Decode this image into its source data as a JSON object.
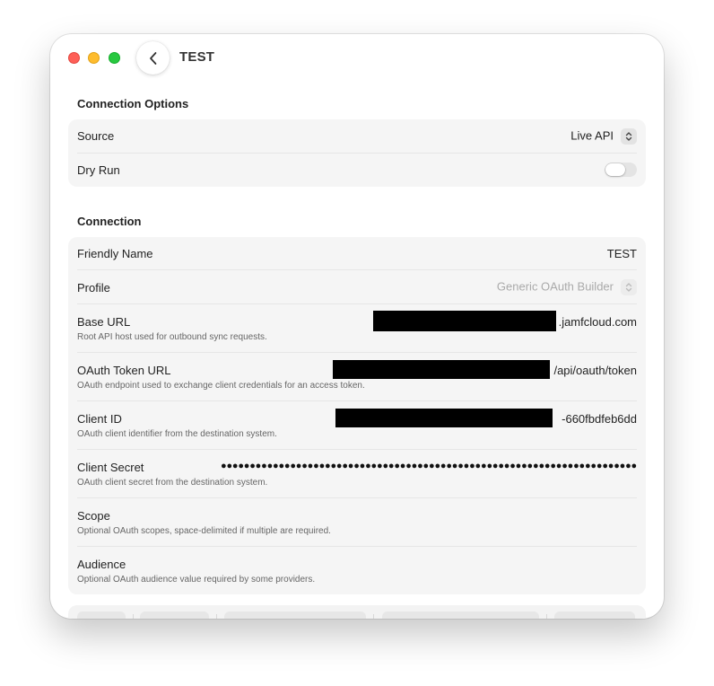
{
  "window": {
    "title": "TEST"
  },
  "connection_options": {
    "heading": "Connection Options",
    "source": {
      "label": "Source",
      "value": "Live API"
    },
    "dry_run": {
      "label": "Dry Run",
      "enabled": false
    }
  },
  "connection": {
    "heading": "Connection",
    "friendly_name": {
      "label": "Friendly Name",
      "value": "TEST"
    },
    "profile": {
      "label": "Profile",
      "value": "Generic OAuth Builder"
    },
    "base_url": {
      "label": "Base URL",
      "value_suffix": ".jamfcloud.com",
      "help": "Root API host used for outbound sync requests."
    },
    "oauth_token_url": {
      "label": "OAuth Token URL",
      "value_suffix": "/api/oauth/token",
      "help": "OAuth endpoint used to exchange client credentials for an access token."
    },
    "client_id": {
      "label": "Client ID",
      "value_suffix": "-660fbdfeb6dd",
      "help": "OAuth client identifier from the destination system."
    },
    "client_secret": {
      "label": "Client Secret",
      "masked": "●●●●●●●●●●●●●●●●●●●●●●●●●●●●●●●●●●●●●●●●●●●●●●●●●●●●●●●●●●●●●●●●●●●●●●●●",
      "help": "OAuth client secret from the destination system."
    },
    "scope": {
      "label": "Scope",
      "help": "Optional OAuth scopes, space-delimited if multiple are required."
    },
    "audience": {
      "label": "Audience",
      "help": "Optional OAuth audience value required by some providers."
    }
  },
  "icons": {
    "back": "chevron-left-icon",
    "select": "chevron-up-down-icon"
  },
  "colors": {
    "close": "#fe5f57",
    "minimize": "#febc2e",
    "maximize": "#28c840"
  }
}
